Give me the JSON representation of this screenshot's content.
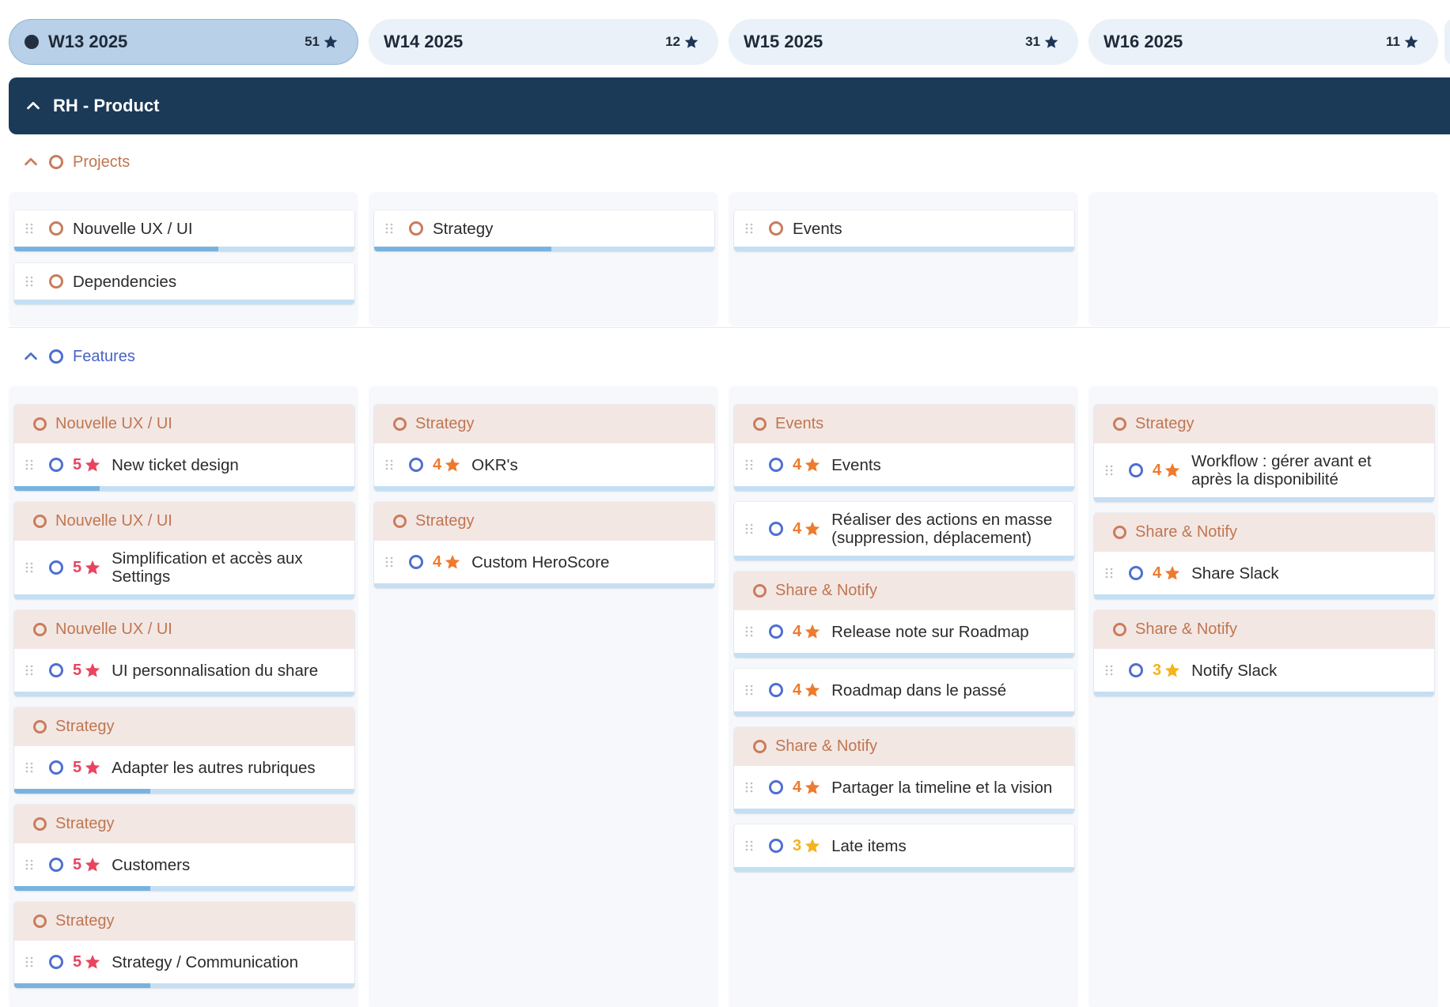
{
  "weeks": [
    {
      "label": "W13 2025",
      "count": "51",
      "active": true
    },
    {
      "label": "W14 2025",
      "count": "12",
      "active": false
    },
    {
      "label": "W15 2025",
      "count": "31",
      "active": false
    },
    {
      "label": "W16 2025",
      "count": "11",
      "active": false
    }
  ],
  "banner": {
    "title": "RH - Product"
  },
  "sections": {
    "projects": {
      "title": "Projects"
    },
    "features": {
      "title": "Features"
    }
  },
  "projects": [
    [
      {
        "title": "Nouvelle UX / UI",
        "progress": 0.6
      },
      {
        "title": "Dependencies",
        "progress": 0
      }
    ],
    [
      {
        "title": "Strategy",
        "progress": 0.52
      }
    ],
    [
      {
        "title": "Events",
        "progress": 0
      }
    ],
    []
  ],
  "features": [
    [
      {
        "parent": "Nouvelle UX / UI",
        "rating": "5",
        "lines": [
          "New ticket design"
        ],
        "progress": 0.25
      },
      {
        "parent": "Nouvelle UX / UI",
        "rating": "5",
        "lines": [
          "Simplification et accès aux",
          "Settings"
        ],
        "progress": 0
      },
      {
        "parent": "Nouvelle UX / UI",
        "rating": "5",
        "lines": [
          "UI personnalisation du share"
        ],
        "progress": 0
      },
      {
        "parent": "Strategy",
        "rating": "5",
        "lines": [
          "Adapter les autres rubriques"
        ],
        "progress": 0.4
      },
      {
        "parent": "Strategy",
        "rating": "5",
        "lines": [
          "Customers"
        ],
        "progress": 0.4
      },
      {
        "parent": "Strategy",
        "rating": "5",
        "lines": [
          "Strategy / Communication"
        ],
        "progress": 0.4
      }
    ],
    [
      {
        "parent": "Strategy",
        "rating": "4",
        "lines": [
          "OKR's"
        ],
        "progress": 0
      },
      {
        "parent": "Strategy",
        "rating": "4",
        "lines": [
          "Custom HeroScore"
        ],
        "progress": 0
      }
    ],
    [
      {
        "parent": "Events",
        "rating": "4",
        "lines": [
          "Events"
        ],
        "progress": 0
      },
      {
        "parent": "",
        "rating": "4",
        "lines": [
          "Réaliser des actions en masse",
          "(suppression, déplacement)"
        ],
        "progress": 0
      },
      {
        "parent": "Share & Notify",
        "rating": "4",
        "lines": [
          "Release note sur Roadmap"
        ],
        "progress": 0
      },
      {
        "parent": "",
        "rating": "4",
        "lines": [
          "Roadmap dans le passé"
        ],
        "progress": 0
      },
      {
        "parent": "Share & Notify",
        "rating": "4",
        "lines": [
          "Partager la timeline et la vision"
        ],
        "progress": 0
      },
      {
        "parent": "",
        "rating": "3",
        "lines": [
          "Late items"
        ],
        "progress": 0
      }
    ],
    [
      {
        "parent": "Strategy",
        "rating": "4",
        "lines": [
          "Workflow : gérer avant et",
          "après la disponibilité"
        ],
        "progress": 0
      },
      {
        "parent": "Share & Notify",
        "rating": "4",
        "lines": [
          "Share Slack"
        ],
        "progress": 0
      },
      {
        "parent": "Share & Notify",
        "rating": "3",
        "lines": [
          "Notify Slack"
        ],
        "progress": 0
      }
    ]
  ],
  "icons": {
    "star": "star-icon",
    "chevron": "chevron-up-icon",
    "grip": "drag-handle-icon",
    "status": "circle-status-icon"
  },
  "colors": {
    "banner": "#1b3a58",
    "rating_5": "#e8445f",
    "rating_4": "#ee7a2e",
    "rating_3": "#f3b31c",
    "project_accent": "#c0764f",
    "feature_accent": "#4763c6"
  }
}
